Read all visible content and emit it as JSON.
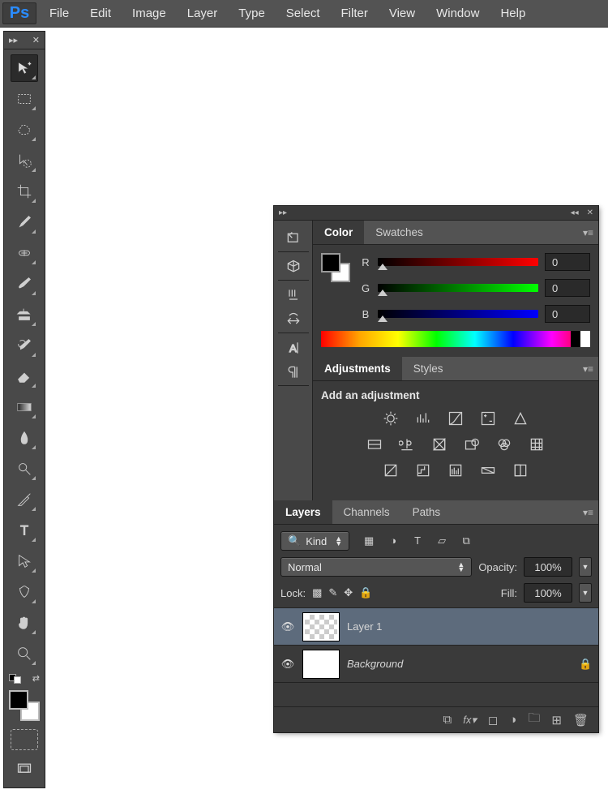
{
  "app": {
    "logo": "Ps"
  },
  "menu": {
    "items": [
      "File",
      "Edit",
      "Image",
      "Layer",
      "Type",
      "Select",
      "Filter",
      "View",
      "Window",
      "Help"
    ]
  },
  "toolbar": {
    "tools": [
      {
        "name": "move-tool"
      },
      {
        "name": "marquee-tool"
      },
      {
        "name": "lasso-tool"
      },
      {
        "name": "quick-select-tool"
      },
      {
        "name": "crop-tool"
      },
      {
        "name": "eyedropper-tool"
      },
      {
        "name": "healing-brush-tool"
      },
      {
        "name": "brush-tool"
      },
      {
        "name": "clone-stamp-tool"
      },
      {
        "name": "history-brush-tool"
      },
      {
        "name": "eraser-tool"
      },
      {
        "name": "gradient-tool"
      },
      {
        "name": "blur-tool"
      },
      {
        "name": "dodge-tool"
      },
      {
        "name": "pen-tool"
      },
      {
        "name": "type-tool"
      },
      {
        "name": "path-select-tool"
      },
      {
        "name": "shape-tool"
      },
      {
        "name": "hand-tool"
      },
      {
        "name": "zoom-tool"
      }
    ]
  },
  "cluster": {
    "iconbar_groups": [
      [
        "history-icon"
      ],
      [
        "cube-3d-icon"
      ],
      [
        "brushes-icon",
        "clone-source-icon"
      ],
      [
        "character-icon",
        "paragraph-icon"
      ]
    ]
  },
  "color": {
    "tabs": [
      "Color",
      "Swatches"
    ],
    "active_tab": 0,
    "channels": [
      {
        "label": "R",
        "value": "0"
      },
      {
        "label": "G",
        "value": "0"
      },
      {
        "label": "B",
        "value": "0"
      }
    ],
    "fg": "#000000",
    "bg": "#ffffff"
  },
  "adjustments": {
    "tabs": [
      "Adjustments",
      "Styles"
    ],
    "active_tab": 0,
    "heading": "Add an adjustment",
    "rows": [
      [
        "brightness-contrast-icon",
        "levels-icon",
        "curves-icon",
        "exposure-icon",
        "vibrance-icon"
      ],
      [
        "hue-saturation-icon",
        "color-balance-icon",
        "black-white-icon",
        "photo-filter-icon",
        "channel-mixer-icon",
        "color-lookup-icon"
      ],
      [
        "invert-icon",
        "posterize-icon",
        "threshold-icon",
        "gradient-map-icon",
        "selective-color-icon"
      ]
    ]
  },
  "layers": {
    "tabs": [
      "Layers",
      "Channels",
      "Paths"
    ],
    "active_tab": 0,
    "filter_label": "Kind",
    "blend_mode": "Normal",
    "opacity_label": "Opacity:",
    "opacity_value": "100%",
    "lock_label": "Lock:",
    "fill_label": "Fill:",
    "fill_value": "100%",
    "items": [
      {
        "name": "Layer 1",
        "visible": true,
        "bg": false,
        "selected": true,
        "locked": false
      },
      {
        "name": "Background",
        "visible": true,
        "bg": true,
        "selected": false,
        "locked": true
      }
    ],
    "footer_icons": [
      "link-icon",
      "fx-icon",
      "mask-icon",
      "adjustment-layer-icon",
      "group-icon",
      "new-layer-icon",
      "delete-icon"
    ]
  }
}
